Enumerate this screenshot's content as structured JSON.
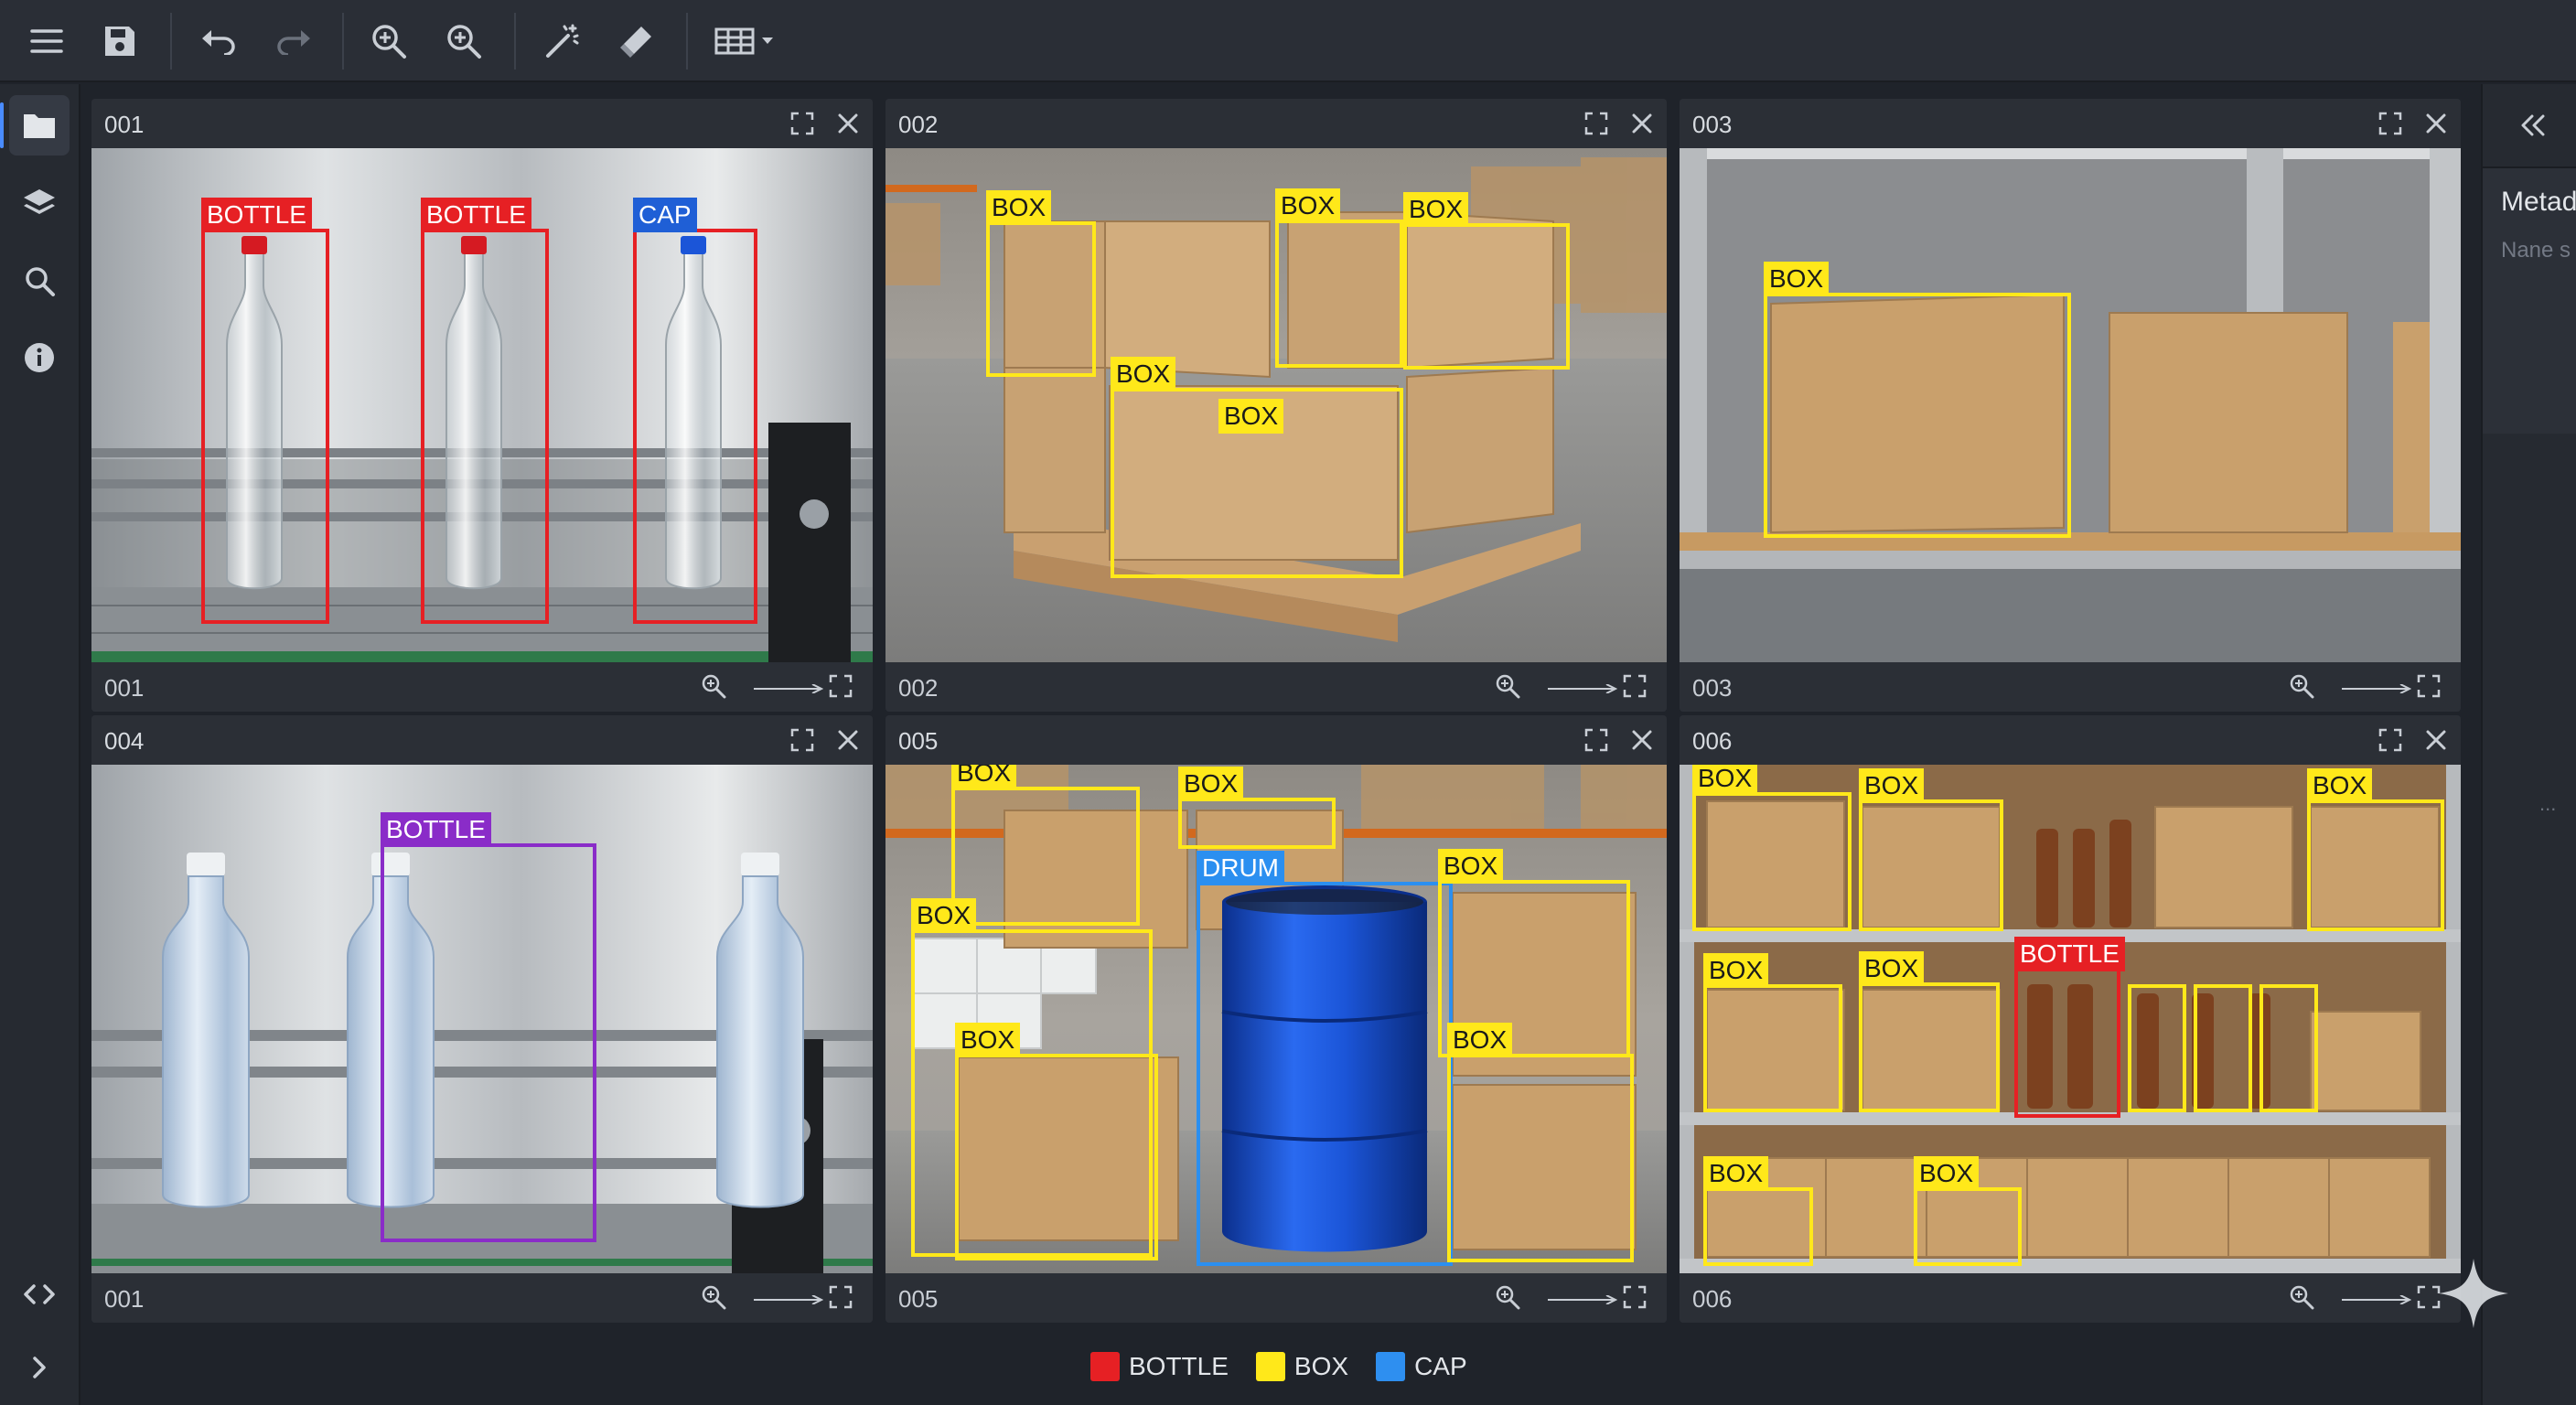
{
  "toolbar": {
    "icons": [
      "menu-icon",
      "save-icon",
      "undo-icon",
      "redo-icon",
      "zoom-in-icon",
      "zoom-out-icon",
      "magic-wand-icon",
      "eraser-icon",
      "grid-layout-icon"
    ]
  },
  "rail": {
    "icons": [
      "folder-icon",
      "layers-icon",
      "search-icon",
      "info-icon",
      "code-icon",
      "chevron-right-icon"
    ]
  },
  "right_panel": {
    "title": "Metad",
    "subtitle": "Nane s",
    "more": "..."
  },
  "panels": [
    {
      "id": "001",
      "title": "001",
      "footer": "001",
      "boxes": [
        {
          "label": "BOTTLE",
          "class": "red"
        },
        {
          "label": "BOTTLE",
          "class": "red"
        },
        {
          "label": "CAP",
          "class": "cap"
        }
      ]
    },
    {
      "id": "002",
      "title": "002",
      "footer": "002",
      "boxes": [
        {
          "label": "BOX",
          "class": "yellow"
        },
        {
          "label": "BOX",
          "class": "yellow"
        },
        {
          "label": "BOX",
          "class": "yellow"
        },
        {
          "label": "BOX",
          "class": "yellow"
        },
        {
          "label": "BOX",
          "class": "yellow"
        }
      ]
    },
    {
      "id": "003",
      "title": "003",
      "footer": "003",
      "boxes": [
        {
          "label": "BOX",
          "class": "yellow"
        }
      ]
    },
    {
      "id": "004",
      "title": "004",
      "footer": "001",
      "boxes": [
        {
          "label": "BOTTLE",
          "class": "purple"
        }
      ]
    },
    {
      "id": "005",
      "title": "005",
      "footer": "005",
      "boxes": [
        {
          "label": "BOX",
          "class": "yellow"
        },
        {
          "label": "BOX",
          "class": "yellow"
        },
        {
          "label": "DRUM",
          "class": "drum"
        },
        {
          "label": "BOX",
          "class": "yellow"
        },
        {
          "label": "BOX",
          "class": "yellow"
        },
        {
          "label": "BOX",
          "class": "yellow"
        },
        {
          "label": "BOX",
          "class": "yellow"
        }
      ]
    },
    {
      "id": "006",
      "title": "006",
      "footer": "006",
      "boxes": [
        {
          "label": "BOX",
          "class": "yellow"
        },
        {
          "label": "BOX",
          "class": "yellow"
        },
        {
          "label": "BOX",
          "class": "yellow"
        },
        {
          "label": "BOX",
          "class": "yellow"
        },
        {
          "label": "BOX",
          "class": "yellow"
        },
        {
          "label": "BOTTLE",
          "class": "red"
        },
        {
          "label": "BOX",
          "class": "yellow"
        },
        {
          "label": "BOX",
          "class": "yellow"
        }
      ]
    }
  ],
  "legend": [
    {
      "label": "BOTTLE",
      "color": "#e62024"
    },
    {
      "label": "BOX",
      "color": "#ffe81a"
    },
    {
      "label": "CAP",
      "color": "#2e8ff0"
    }
  ]
}
